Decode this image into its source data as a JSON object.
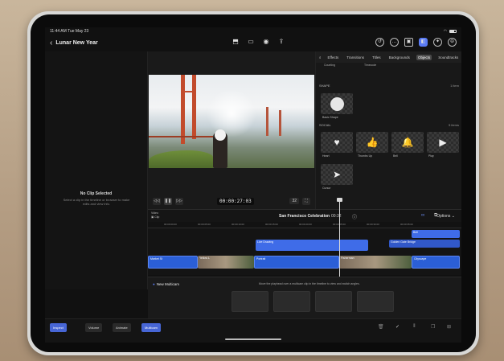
{
  "status": {
    "time": "11:44 AM",
    "date": "Tue May 23"
  },
  "header": {
    "title": "Lunar New Year"
  },
  "left_panel": {
    "title": "No Clip Selected",
    "subtitle": "Select a clip in the timeline or browser to make edits and view info."
  },
  "viewer": {
    "timecode": "00:00:27:03",
    "zoom": "32"
  },
  "browser": {
    "tabs": [
      "Effects",
      "Transitions",
      "Titles",
      "Backgrounds",
      "Objects",
      "Soundtracks"
    ],
    "active_tab": "Objects",
    "top_items": [
      "Counting",
      "Timecode"
    ],
    "sections": [
      {
        "title": "SHAPE",
        "count": "1 item",
        "items": [
          "Basic Shape"
        ]
      },
      {
        "title": "SOCIAL",
        "count": "5 items",
        "items": [
          "Heart",
          "Thumbs Up",
          "Bell",
          "Play",
          "Cursor"
        ]
      }
    ]
  },
  "timeline": {
    "badge_line1": "Video",
    "badge_line2": "Clip",
    "project_name": "San Francisco Celebration",
    "duration": "00:32",
    "options_label": "Options",
    "ruler": [
      "00:00:00:00",
      "00:00:05:00",
      "00:00:10:00",
      "00:00:15:00",
      "00:00:20:00",
      "00:00:25:00",
      "00:00:30:00",
      "00:00:35:00"
    ],
    "clips": {
      "live_drawing": "Live Drawing",
      "bell": "Bell",
      "golden_gate": "Golden Gate Bridge",
      "c1": "Market St",
      "c2": "Yellow L",
      "c3": "Portrait",
      "c4": "Fisherman",
      "c5": "Cityscape"
    }
  },
  "multicam": {
    "label": "New Multicam",
    "info": "Move the playhead over a multicam clip in the timeline to view and switch angles."
  },
  "bottombar": {
    "inspect": "Inspect",
    "volume": "Volume",
    "animate": "Animate",
    "multicam": "Multicam"
  },
  "colors": {
    "accent": "#5b7cf5",
    "clip_blue": "#3f6ce8"
  }
}
